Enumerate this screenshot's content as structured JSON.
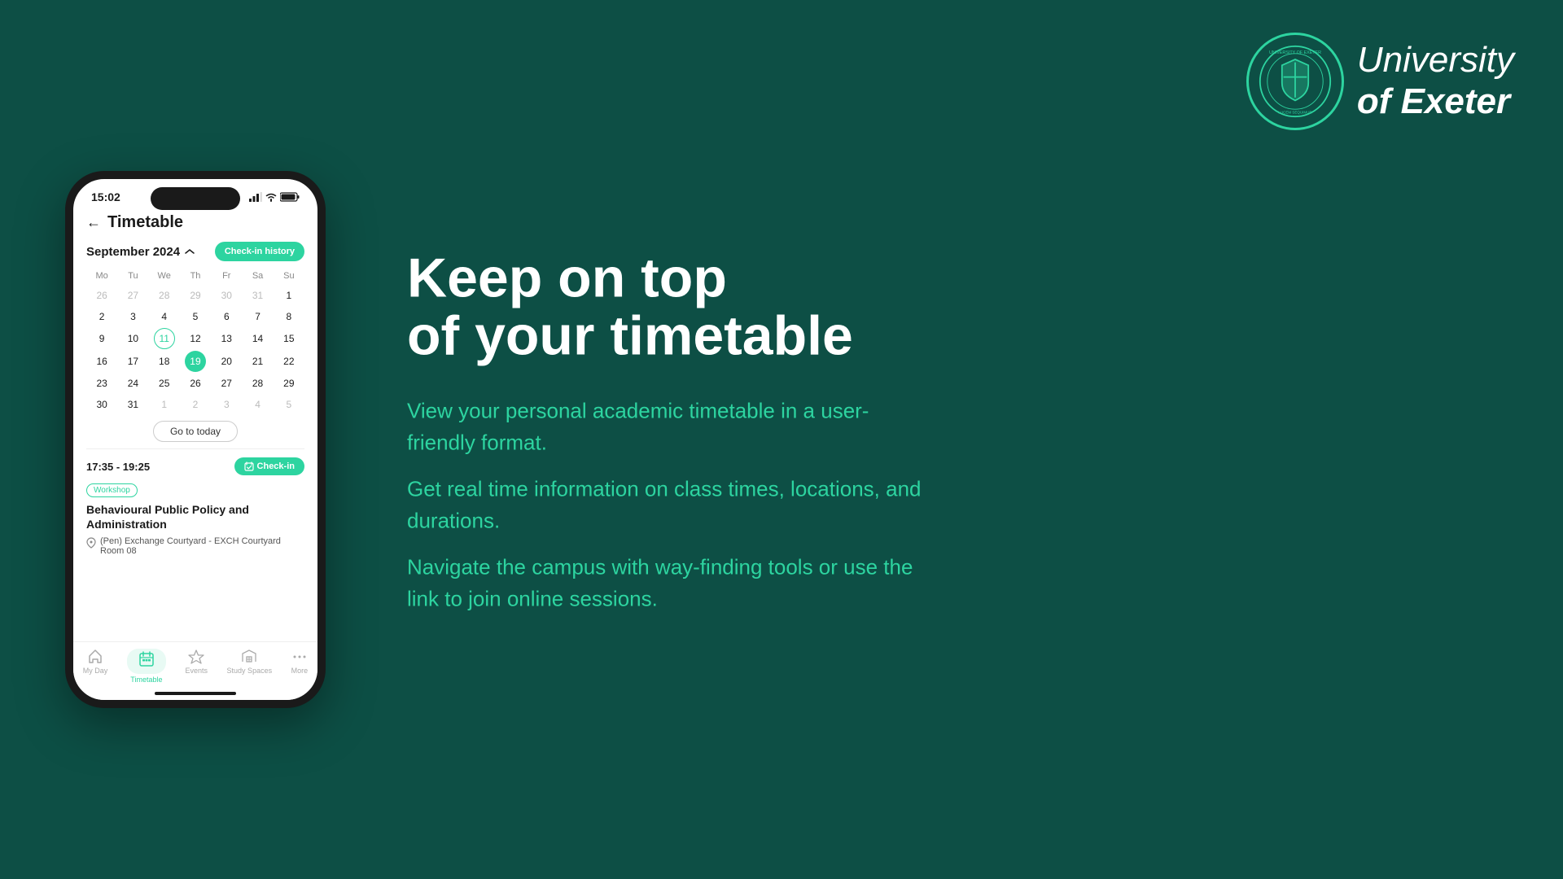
{
  "university": {
    "name_italic": "University",
    "name_bold": "of Exeter"
  },
  "phone": {
    "status_time": "15:02",
    "header_title": "Timetable",
    "month_label": "September 2024",
    "checkin_history_label": "Check-in history",
    "weekdays": [
      "Mo",
      "Tu",
      "We",
      "Th",
      "Fr",
      "Sa",
      "Su"
    ],
    "weeks": [
      [
        {
          "n": "26",
          "m": true
        },
        {
          "n": "27",
          "m": true
        },
        {
          "n": "28",
          "m": true
        },
        {
          "n": "29",
          "m": true
        },
        {
          "n": "30",
          "m": true
        },
        {
          "n": "31",
          "m": true
        },
        {
          "n": "1",
          "m": false
        }
      ],
      [
        {
          "n": "2"
        },
        {
          "n": "3"
        },
        {
          "n": "4"
        },
        {
          "n": "5"
        },
        {
          "n": "6"
        },
        {
          "n": "7"
        },
        {
          "n": "8"
        }
      ],
      [
        {
          "n": "9"
        },
        {
          "n": "10"
        },
        {
          "n": "11",
          "ring": true
        },
        {
          "n": "12"
        },
        {
          "n": "13"
        },
        {
          "n": "14"
        },
        {
          "n": "15"
        }
      ],
      [
        {
          "n": "16"
        },
        {
          "n": "17"
        },
        {
          "n": "18"
        },
        {
          "n": "19",
          "sel": true
        },
        {
          "n": "20"
        },
        {
          "n": "21"
        },
        {
          "n": "22"
        }
      ],
      [
        {
          "n": "23"
        },
        {
          "n": "24"
        },
        {
          "n": "25"
        },
        {
          "n": "26"
        },
        {
          "n": "27"
        },
        {
          "n": "28"
        },
        {
          "n": "29"
        }
      ],
      [
        {
          "n": "30"
        },
        {
          "n": "31"
        },
        {
          "n": "1",
          "m": true
        },
        {
          "n": "2",
          "m": true
        },
        {
          "n": "3",
          "m": true
        },
        {
          "n": "4",
          "m": true
        },
        {
          "n": "5",
          "m": true
        }
      ]
    ],
    "go_today_label": "Go to today",
    "event_time": "17:35 - 19:25",
    "checkin_label": "Check-in",
    "event_tag": "Workshop",
    "event_name": "Behavioural Public Policy and Administration",
    "event_location": "(Pen) Exchange Courtyard - EXCH Courtyard Room 08",
    "nav_items": [
      {
        "label": "My Day",
        "active": false
      },
      {
        "label": "Timetable",
        "active": true
      },
      {
        "label": "Events",
        "active": false
      },
      {
        "label": "Study Spaces",
        "active": false
      },
      {
        "label": "More",
        "active": false
      }
    ]
  },
  "headline_line1": "Keep on top",
  "headline_line2": "of your timetable",
  "body_points": [
    "View your personal academic timetable in a user-friendly format.",
    "Get real time information on class times, locations, and durations.",
    "Navigate the campus with way-finding tools or use the link to join online sessions."
  ]
}
